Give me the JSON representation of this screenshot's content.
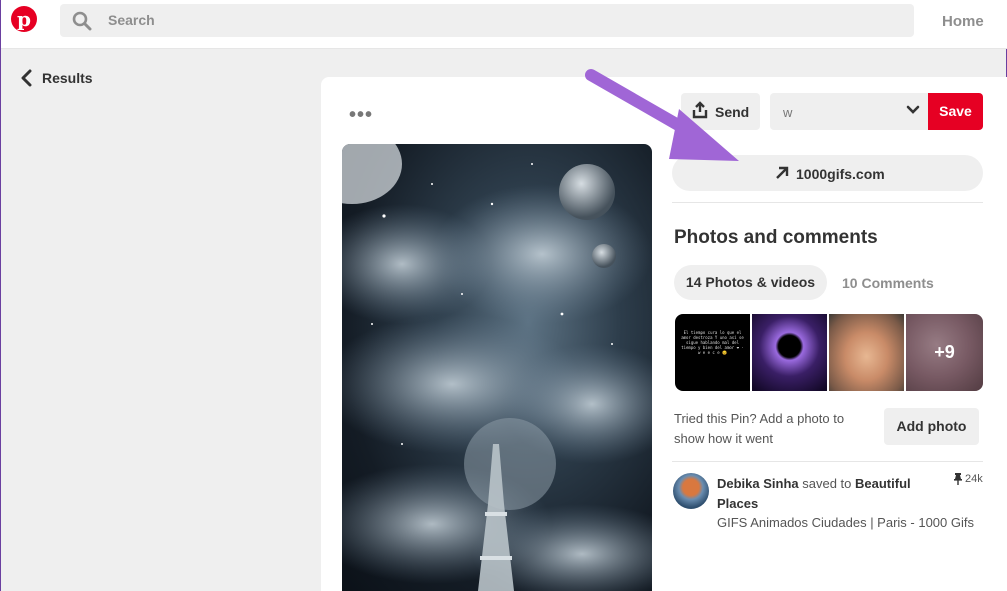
{
  "header": {
    "logo_letter": "p",
    "search_placeholder": "Search",
    "home_label": "Home"
  },
  "nav": {
    "back_label": "Results"
  },
  "pin": {
    "more_label": "•••",
    "send_label": "Send",
    "board_value": "w",
    "save_label": "Save",
    "source_link": "1000gifs.com",
    "section_title": "Photos and comments",
    "tabs": [
      {
        "label": "14 Photos & videos",
        "active": true
      },
      {
        "label": "10 Comments",
        "active": false
      }
    ],
    "thumbnails": [
      {
        "kind": "text-image",
        "text": "El tiempo cura lo que el amor destroza Y uno así se sigue hablando mal del tiempo y bien del amor ❤ · w e e c e 😊"
      },
      {
        "kind": "image",
        "alt": "purple-planet"
      },
      {
        "kind": "image",
        "alt": "baby-face"
      },
      {
        "kind": "more",
        "text": "+9"
      }
    ],
    "tried_text": "Tried this Pin? Add a photo to show how it went",
    "add_photo_label": "Add photo",
    "saver": {
      "name": "Debika Sinha",
      "action": " saved to ",
      "board": "Beautiful Places",
      "board_desc": "GIFS Animados Ciudades | Paris - 1000 Gifs",
      "repin_count": "24k"
    }
  },
  "colors": {
    "brand_red": "#e60023",
    "annotation_arrow": "#a066d6"
  }
}
